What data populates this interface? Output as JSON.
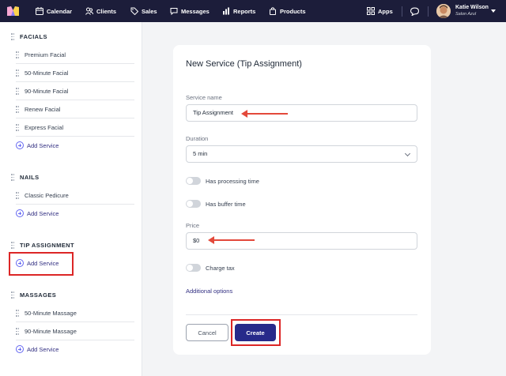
{
  "topbar": {
    "nav": [
      {
        "label": "Calendar",
        "icon": "calendar-icon"
      },
      {
        "label": "Clients",
        "icon": "clients-icon"
      },
      {
        "label": "Sales",
        "icon": "sales-tag-icon"
      },
      {
        "label": "Messages",
        "icon": "messages-icon"
      },
      {
        "label": "Reports",
        "icon": "reports-chart-icon"
      },
      {
        "label": "Products",
        "icon": "products-icon"
      }
    ],
    "apps_label": "Apps",
    "user": {
      "name": "Katie Wilson",
      "location": "Salon Azul"
    },
    "bg_color": "#1c1d3a"
  },
  "sidebar": {
    "sections": [
      {
        "title": "FACIALS",
        "services": [
          "Premium Facial",
          "50-Minute Facial",
          "90-Minute Facial",
          "Renew Facial",
          "Express Facial"
        ],
        "add_label": "Add Service"
      },
      {
        "title": "NAILS",
        "services": [
          "Classic Pedicure"
        ],
        "add_label": "Add Service"
      },
      {
        "title": "TIP ASSIGNMENT",
        "services": [],
        "add_label": "Add Service"
      },
      {
        "title": "MASSAGES",
        "services": [
          "50-Minute Massage",
          "90-Minute Massage"
        ],
        "add_label": "Add Service"
      }
    ]
  },
  "form": {
    "title": "New Service (Tip Assignment)",
    "service_name": {
      "label": "Service name",
      "value": "Tip Assignment"
    },
    "duration": {
      "label": "Duration",
      "value": "5 min"
    },
    "processing_label": "Has processing time",
    "buffer_label": "Has buffer time",
    "price": {
      "label": "Price",
      "value": "$0"
    },
    "tax_label": "Charge tax",
    "additional_options": "Additional options",
    "cancel_label": "Cancel",
    "create_label": "Create"
  },
  "colors": {
    "accent": "#272a8a",
    "annotation": "#dc2626"
  }
}
